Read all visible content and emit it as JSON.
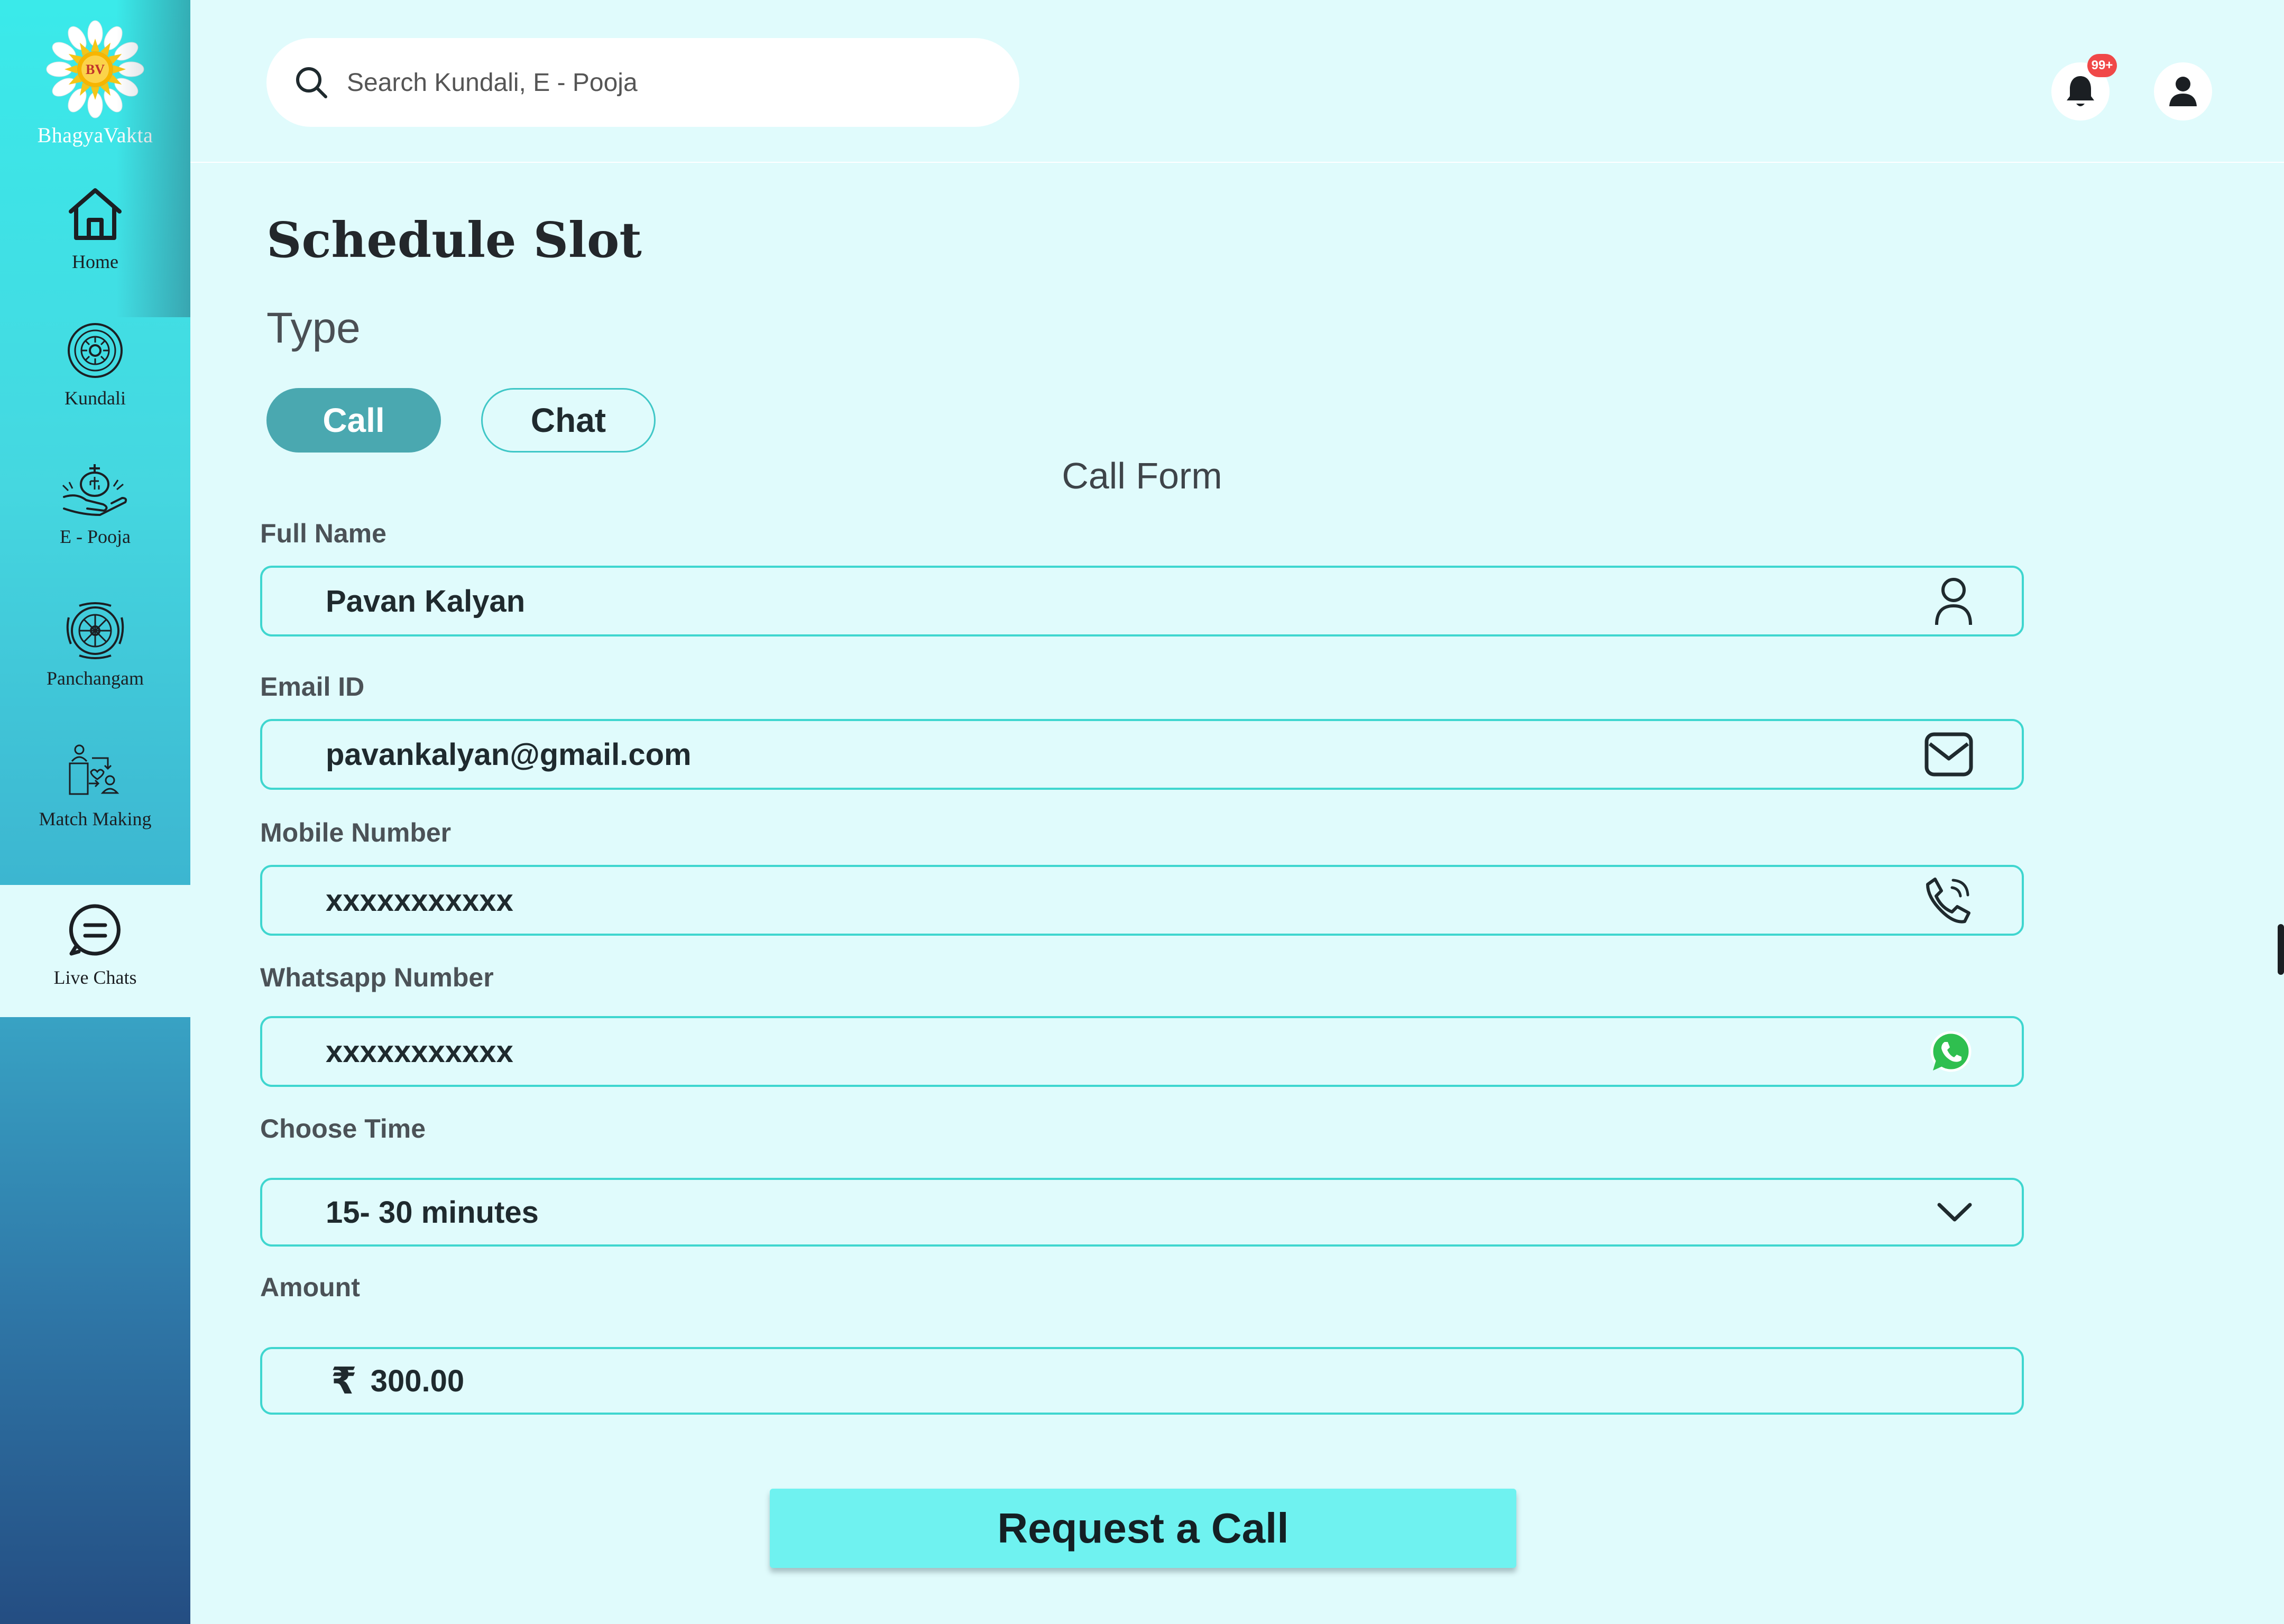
{
  "brand": {
    "name": "BhagyaVakta",
    "logo_text": "BV"
  },
  "sidebar": {
    "items": [
      {
        "label": "Home",
        "icon": "home-icon"
      },
      {
        "label": "Kundali",
        "icon": "kundali-icon"
      },
      {
        "label": "E - Pooja",
        "icon": "pooja-icon"
      },
      {
        "label": "Panchangam",
        "icon": "panchangam-icon"
      },
      {
        "label": "Match Making",
        "icon": "match-making-icon"
      },
      {
        "label": "Live Chats",
        "icon": "chat-icon",
        "active": true
      }
    ]
  },
  "header": {
    "search_placeholder": "Search Kundali, E - Pooja",
    "notification_badge": "99+"
  },
  "page": {
    "title": "Schedule Slot",
    "type_label": "Type",
    "type_options": [
      "Call",
      "Chat"
    ],
    "selected_type": "Call",
    "form_title": "Call Form"
  },
  "form": {
    "full_name": {
      "label": "Full Name",
      "value": "Pavan Kalyan",
      "icon": "person-icon"
    },
    "email": {
      "label": "Email ID",
      "value": "pavankalyan@gmail.com",
      "icon": "mail-icon"
    },
    "mobile": {
      "label": "Mobile Number",
      "value": "xxxxxxxxxxx",
      "icon": "phone-icon"
    },
    "whatsapp": {
      "label": "Whatsapp Number",
      "value": "xxxxxxxxxxx",
      "icon": "whatsapp-icon"
    },
    "time": {
      "label": "Choose Time",
      "value": "15- 30 minutes",
      "icon": "chevron-down-icon"
    },
    "amount": {
      "label": "Amount",
      "currency": "₹",
      "value": "300.00"
    }
  },
  "cta": {
    "label": "Request a Call"
  },
  "colors": {
    "background": "#e0fbfc",
    "accent": "#3fd6cf",
    "toggle_active": "#4aa8b0",
    "cta": "#6ff2f0",
    "badge": "#f04848"
  }
}
